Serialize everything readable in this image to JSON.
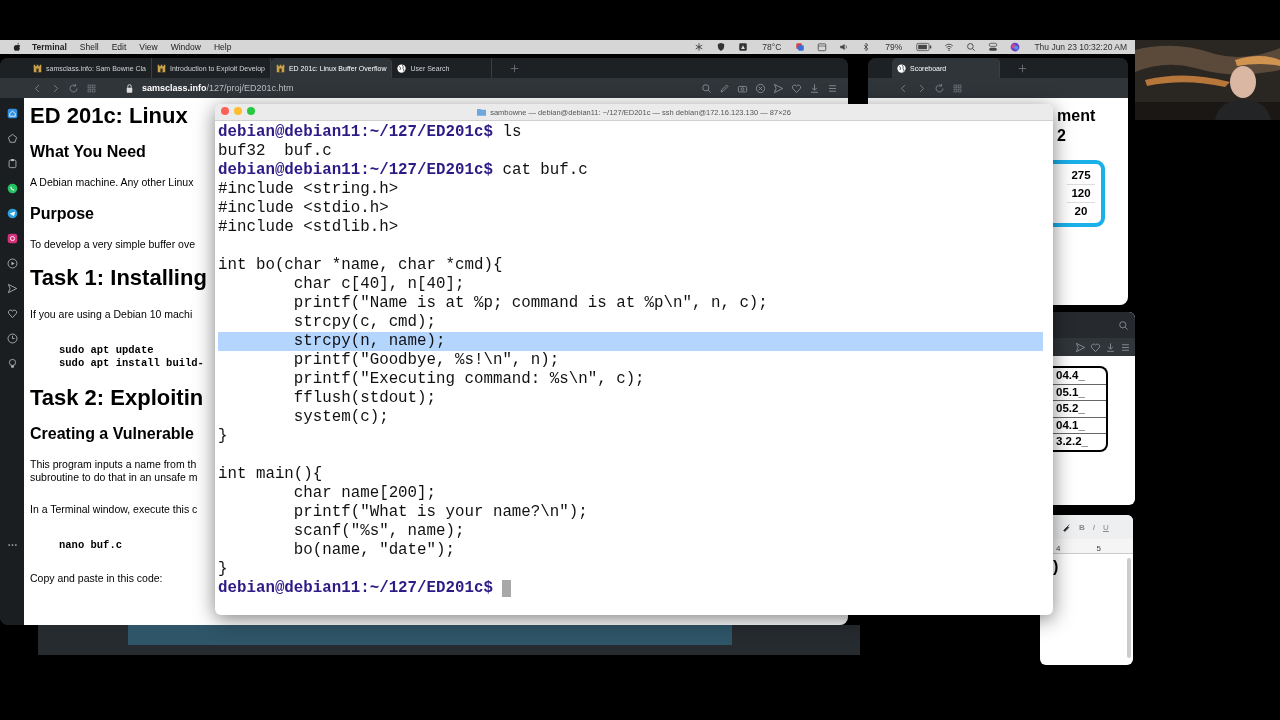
{
  "menu_bar": {
    "app": "Terminal",
    "menus": [
      "Shell",
      "Edit",
      "View",
      "Window",
      "Help"
    ],
    "temperature": "78°C",
    "battery": "79%",
    "clock": "Thu Jun 23  10:32:20 AM"
  },
  "browser": {
    "tabs": [
      {
        "title": "samsclass.info: Sam Bowne Cla",
        "selected": false
      },
      {
        "title": "Introduction to Exploit Develop",
        "selected": false
      },
      {
        "title": "ED 201c: Linux Buffer Overflow",
        "selected": true
      },
      {
        "title": "User Search",
        "selected": false
      }
    ],
    "url_host": "samsclass.info",
    "url_path": "/127/proj/ED201c.htm",
    "page": [
      {
        "kind": "h1",
        "lines": [
          "ED 201c: Linux"
        ]
      },
      {
        "kind": "h2",
        "lines": [
          "What You Need"
        ]
      },
      {
        "kind": "p",
        "lines": [
          "A Debian machine. Any other Linux"
        ]
      },
      {
        "kind": "h2",
        "lines": [
          "Purpose"
        ]
      },
      {
        "kind": "p",
        "lines": [
          "To develop a very simple buffer ove"
        ]
      },
      {
        "kind": "h1",
        "lines": [
          "Task 1: Installing"
        ]
      },
      {
        "kind": "p",
        "lines": [
          "If you are using a Debian 10 machi"
        ]
      },
      {
        "kind": "code",
        "lines": [
          "sudo apt update",
          "sudo apt install build-"
        ]
      },
      {
        "kind": "h1",
        "lines": [
          "Task 2: Exploitin"
        ]
      },
      {
        "kind": "h2",
        "lines": [
          "Creating a Vulnerable"
        ]
      },
      {
        "kind": "p",
        "lines": [
          "This program inputs a name from th",
          "subroutine to do that in an unsafe m"
        ]
      },
      {
        "kind": "p",
        "lines": [
          "In a Terminal window, execute this c"
        ]
      },
      {
        "kind": "code",
        "lines": [
          "nano buf.c"
        ]
      },
      {
        "kind": "p",
        "lines": [
          "Copy and paste in this code:"
        ]
      }
    ]
  },
  "scoreboard_window": {
    "tab": "Scoreboard",
    "heading": [
      "ment",
      "2"
    ],
    "scores": [
      "275",
      "120",
      "20"
    ]
  },
  "list_window": {
    "rows": [
      "04.4_",
      "05.1_",
      "05.2_",
      "04.1_",
      "3.2.2_"
    ]
  },
  "editor_window": {
    "format_buttons": [
      "B",
      "I",
      "U"
    ],
    "ruler": [
      "4",
      "5"
    ],
    "text": ")"
  },
  "terminal": {
    "title": "sambowne — debian@debian11: ~/127/ED201c — ssh debian@172.16.123.130 — 87×26",
    "lines": [
      {
        "kind": "prompt",
        "prompt": "debian@debian11:~/127/ED201c$",
        "command": "ls",
        "selected": false
      },
      {
        "kind": "output",
        "text": "buf32  buf.c",
        "selected": false
      },
      {
        "kind": "prompt",
        "prompt": "debian@debian11:~/127/ED201c$",
        "command": "cat buf.c",
        "selected": false
      },
      {
        "kind": "output",
        "text": "#include <string.h>",
        "selected": false
      },
      {
        "kind": "output",
        "text": "#include <stdio.h>",
        "selected": false
      },
      {
        "kind": "output",
        "text": "#include <stdlib.h>",
        "selected": false
      },
      {
        "kind": "blank"
      },
      {
        "kind": "output",
        "text": "int bo(char *name, char *cmd){",
        "selected": false
      },
      {
        "kind": "output",
        "text": "        char c[40], n[40];",
        "selected": false
      },
      {
        "kind": "output",
        "text": "        printf(\"Name is at %p; command is at %p\\n\", n, c);",
        "selected": false
      },
      {
        "kind": "output",
        "text": "        strcpy(c, cmd);",
        "selected": false
      },
      {
        "kind": "output",
        "text": "        strcpy(n, name);",
        "selected": true
      },
      {
        "kind": "output",
        "text": "        printf(\"Goodbye, %s!\\n\", n);",
        "selected": false
      },
      {
        "kind": "output",
        "text": "        printf(\"Executing command: %s\\n\", c);",
        "selected": false
      },
      {
        "kind": "output",
        "text": "        fflush(stdout);",
        "selected": false
      },
      {
        "kind": "output",
        "text": "        system(c);",
        "selected": false
      },
      {
        "kind": "output",
        "text": "}",
        "selected": false
      },
      {
        "kind": "blank"
      },
      {
        "kind": "output",
        "text": "int main(){",
        "selected": false
      },
      {
        "kind": "output",
        "text": "        char name[200];",
        "selected": false
      },
      {
        "kind": "output",
        "text": "        printf(\"What is your name?\\n\");",
        "selected": false
      },
      {
        "kind": "output",
        "text": "        scanf(\"%s\", name);",
        "selected": false
      },
      {
        "kind": "output",
        "text": "        bo(name, \"date\");",
        "selected": false
      },
      {
        "kind": "output",
        "text": "}",
        "selected": false
      },
      {
        "kind": "prompt",
        "prompt": "debian@debian11:~/127/ED201c$",
        "cursor": true,
        "selected": false
      }
    ]
  }
}
